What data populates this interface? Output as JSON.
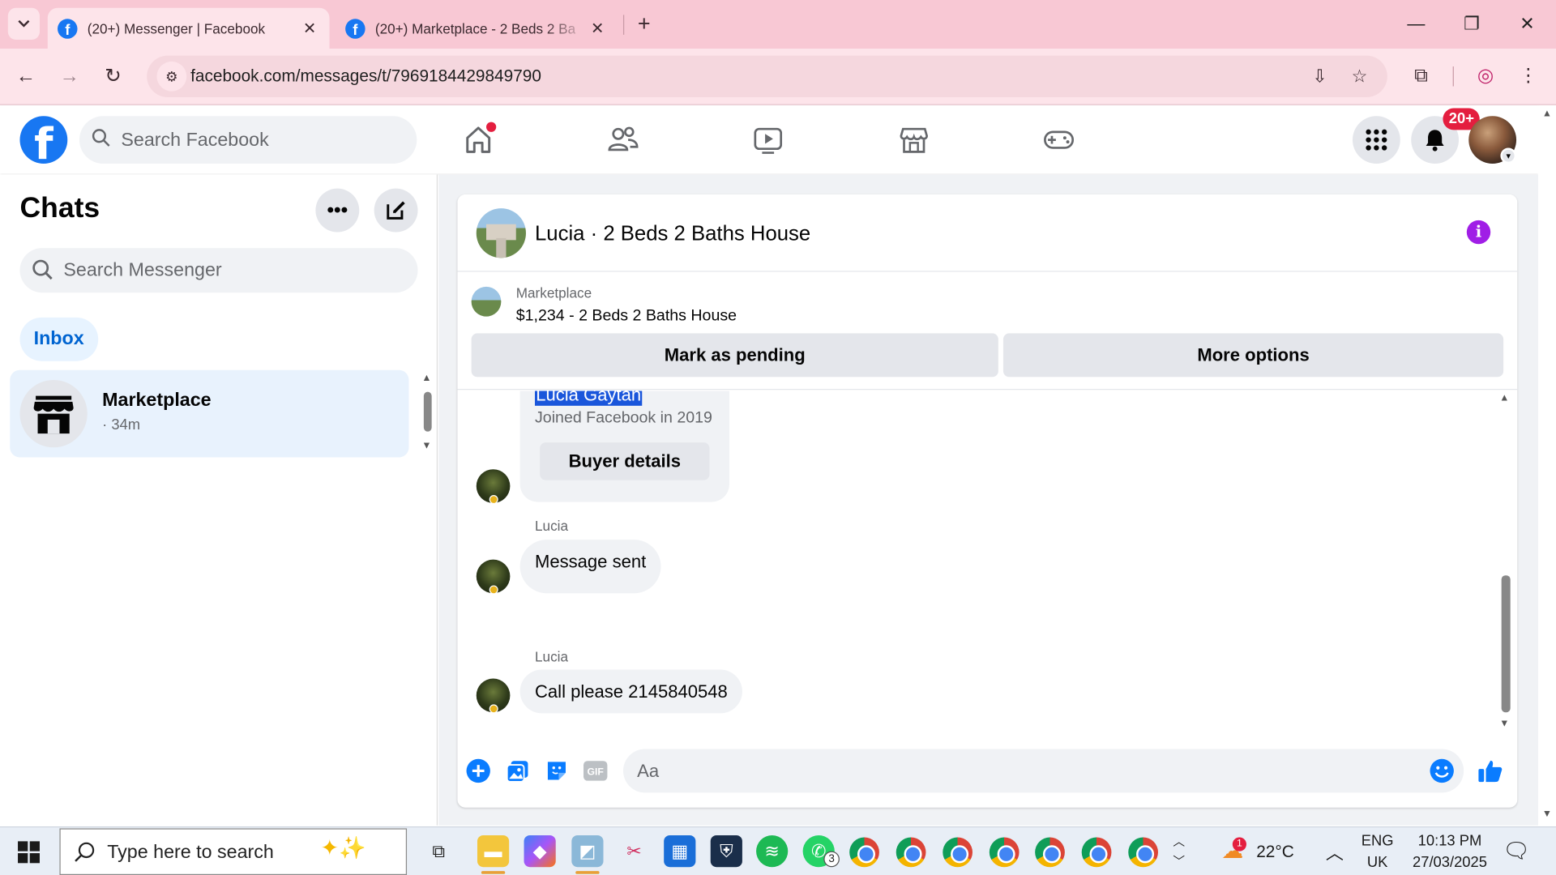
{
  "browser": {
    "tabs": [
      {
        "title": "(20+) Messenger | Facebook",
        "active": true
      },
      {
        "title": "(20+) Marketplace - 2 Beds 2 Ba",
        "active": false
      }
    ],
    "url": "facebook.com/messages/t/7969184429849790"
  },
  "fb_header": {
    "search_placeholder": "Search Facebook",
    "notification_badge": "20+"
  },
  "sidebar": {
    "title": "Chats",
    "search_placeholder": "Search Messenger",
    "filter_label": "Inbox",
    "chats": [
      {
        "name": "Marketplace",
        "time": "· 34m"
      }
    ]
  },
  "conversation": {
    "title": "Lucia · 2 Beds 2 Baths House",
    "marketplace": {
      "label": "Marketplace",
      "listing": "$1,234 - 2 Beds 2 Baths House",
      "mark_pending": "Mark as pending",
      "more_options": "More options"
    },
    "profile_card": {
      "name": "Lucia Gaytan",
      "joined": "Joined Facebook in 2019",
      "buyer_details": "Buyer details"
    },
    "messages": [
      {
        "sender": "Lucia",
        "text": "Message sent"
      },
      {
        "sender": "Lucia",
        "text": "Call please 2145840548"
      }
    ],
    "composer_placeholder": "Aa"
  },
  "taskbar": {
    "search_placeholder": "Type here to search",
    "whatsapp_badge": "3",
    "weather_badge": "1",
    "temperature": "22°C",
    "language": "ENG",
    "region": "UK",
    "time": "10:13 PM",
    "date": "27/03/2025"
  },
  "colors": {
    "fb_blue": "#1877f2",
    "tab_bar_pink": "#f8c8d4",
    "toolbar_pink": "#fde4ea",
    "badge_red": "#e41e3f",
    "info_purple": "#a01ee6"
  }
}
